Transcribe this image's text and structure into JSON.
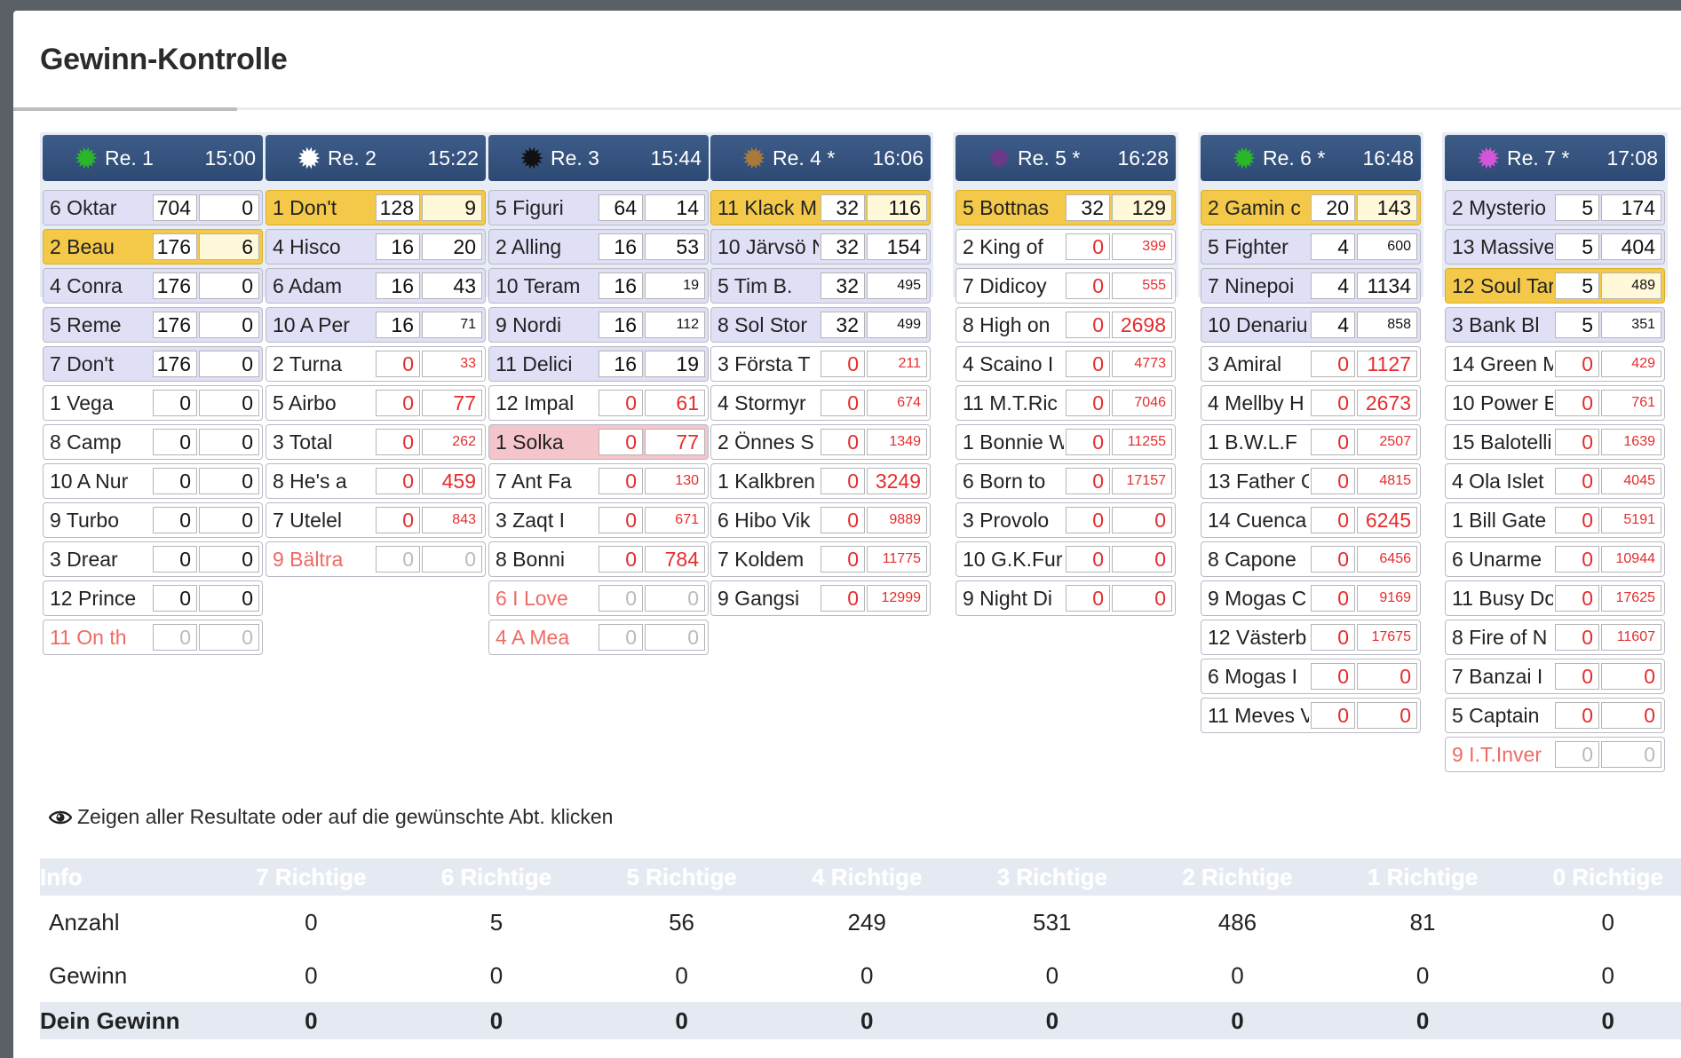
{
  "title": "Gewinn-Kontrolle",
  "races": [
    {
      "label": "Re. 1",
      "time": "15:00",
      "icon_color": "#2bb52b",
      "icon": "starburst-icon",
      "rows": [
        {
          "name": "6 Oktar",
          "v1": "704",
          "v2": "0",
          "style": "blue"
        },
        {
          "name": "2 Beau",
          "v1": "176",
          "v2": "6",
          "style": "gold"
        },
        {
          "name": "4 Conra",
          "v1": "176",
          "v2": "0",
          "style": "blue"
        },
        {
          "name": "5 Reme",
          "v1": "176",
          "v2": "0",
          "style": "blue"
        },
        {
          "name": "7 Don't",
          "v1": "176",
          "v2": "0",
          "style": "blue"
        },
        {
          "name": "1 Vega",
          "v1": "0",
          "v2": "0",
          "style": ""
        },
        {
          "name": "8 Camp",
          "v1": "0",
          "v2": "0",
          "style": ""
        },
        {
          "name": "10 A Nur",
          "v1": "0",
          "v2": "0",
          "style": ""
        },
        {
          "name": "9 Turbo",
          "v1": "0",
          "v2": "0",
          "style": ""
        },
        {
          "name": "3 Drear",
          "v1": "0",
          "v2": "0",
          "style": ""
        },
        {
          "name": "12 Prince",
          "v1": "0",
          "v2": "0",
          "style": ""
        },
        {
          "name": "11 On th",
          "v1": "0",
          "v2": "0",
          "style": "scratched"
        }
      ]
    },
    {
      "label": "Re. 2",
      "time": "15:22",
      "icon_color": "#ffffff",
      "icon": "starburst-icon",
      "rows": [
        {
          "name": "1 Don't",
          "v1": "128",
          "v2": "9",
          "style": "gold"
        },
        {
          "name": "4 Hisco",
          "v1": "16",
          "v2": "20",
          "style": "blue"
        },
        {
          "name": "6 Adam",
          "v1": "16",
          "v2": "43",
          "style": "blue"
        },
        {
          "name": "10 A Per",
          "v1": "16",
          "v2": "71",
          "style": "blue",
          "v2small": true
        },
        {
          "name": "2 Turna",
          "v1": "0",
          "v2": "33",
          "style": "",
          "red": true,
          "v2small": true
        },
        {
          "name": "5 Airbo",
          "v1": "0",
          "v2": "77",
          "style": "",
          "red": true
        },
        {
          "name": "3 Total",
          "v1": "0",
          "v2": "262",
          "style": "",
          "red": true,
          "v2small": true
        },
        {
          "name": "8 He's a",
          "v1": "0",
          "v2": "459",
          "style": "",
          "red": true
        },
        {
          "name": "7 Utelel",
          "v1": "0",
          "v2": "843",
          "style": "",
          "red": true,
          "v2small": true
        },
        {
          "name": "9 Bältra",
          "v1": "0",
          "v2": "0",
          "style": "scratched"
        }
      ]
    },
    {
      "label": "Re. 3",
      "time": "15:44",
      "icon_color": "#111111",
      "icon": "starburst-icon",
      "rows": [
        {
          "name": "5 Figuri",
          "v1": "64",
          "v2": "14",
          "style": "blue"
        },
        {
          "name": "2 Alling",
          "v1": "16",
          "v2": "53",
          "style": "blue"
        },
        {
          "name": "10 Teram",
          "v1": "16",
          "v2": "19",
          "style": "blue",
          "v2small": true
        },
        {
          "name": "9 Nordi",
          "v1": "16",
          "v2": "112",
          "style": "blue",
          "v2small": true
        },
        {
          "name": "11 Delici",
          "v1": "16",
          "v2": "19",
          "style": "blue"
        },
        {
          "name": "12 Impal",
          "v1": "0",
          "v2": "61",
          "style": "",
          "red": true
        },
        {
          "name": "1 Solka",
          "v1": "0",
          "v2": "77",
          "style": "pink",
          "red": true
        },
        {
          "name": "7 Ant Fa",
          "v1": "0",
          "v2": "130",
          "style": "",
          "red": true,
          "v2small": true
        },
        {
          "name": "3 Zaqt I",
          "v1": "0",
          "v2": "671",
          "style": "",
          "red": true,
          "v2small": true
        },
        {
          "name": "8 Bonni",
          "v1": "0",
          "v2": "784",
          "style": "",
          "red": true
        },
        {
          "name": "6 I Love",
          "v1": "0",
          "v2": "0",
          "style": "scratched"
        },
        {
          "name": "4 A Mea",
          "v1": "0",
          "v2": "0",
          "style": "scratched"
        }
      ]
    },
    {
      "label": "Re. 4 *",
      "time": "16:06",
      "icon_color": "#a77a3c",
      "icon": "starburst-icon",
      "rows": [
        {
          "name": "11 Klack M",
          "v1": "32",
          "v2": "116",
          "style": "gold"
        },
        {
          "name": "10 Järvsö N",
          "v1": "32",
          "v2": "154",
          "style": "blue"
        },
        {
          "name": "5 Tim B.",
          "v1": "32",
          "v2": "495",
          "style": "blue",
          "v2small": true
        },
        {
          "name": "8 Sol Stor",
          "v1": "32",
          "v2": "499",
          "style": "blue",
          "v2small": true
        },
        {
          "name": "3 Första T",
          "v1": "0",
          "v2": "211",
          "style": "",
          "red": true,
          "v2small": true
        },
        {
          "name": "4 Stormyr",
          "v1": "0",
          "v2": "674",
          "style": "",
          "red": true,
          "v2small": true
        },
        {
          "name": "2 Önnes S",
          "v1": "0",
          "v2": "1349",
          "style": "",
          "red": true,
          "v2small": true
        },
        {
          "name": "1 Kalkbren",
          "v1": "0",
          "v2": "3249",
          "style": "",
          "red": true
        },
        {
          "name": "6 Hibo Vik",
          "v1": "0",
          "v2": "9889",
          "style": "",
          "red": true,
          "v2small": true
        },
        {
          "name": "7 Koldem",
          "v1": "0",
          "v2": "11775",
          "style": "",
          "red": true,
          "v2small": true
        },
        {
          "name": "9 Gangsi",
          "v1": "0",
          "v2": "12999",
          "style": "",
          "red": true,
          "v2small": true
        }
      ]
    },
    {
      "label": "Re. 5 *",
      "time": "16:28",
      "icon_color": "#6a3a8a",
      "icon": "starburst-icon",
      "rows": [
        {
          "name": "5 Bottnas",
          "v1": "32",
          "v2": "129",
          "style": "gold"
        },
        {
          "name": "2 King of",
          "v1": "0",
          "v2": "399",
          "style": "",
          "red": true,
          "v2small": true
        },
        {
          "name": "7 Didicoy",
          "v1": "0",
          "v2": "555",
          "style": "",
          "red": true,
          "v2small": true
        },
        {
          "name": "8 High on",
          "v1": "0",
          "v2": "2698",
          "style": "",
          "red": true
        },
        {
          "name": "4 Scaino I",
          "v1": "0",
          "v2": "4773",
          "style": "",
          "red": true,
          "v2small": true
        },
        {
          "name": "11 M.T.Ric",
          "v1": "0",
          "v2": "7046",
          "style": "",
          "red": true,
          "v2small": true
        },
        {
          "name": "1 Bonnie W",
          "v1": "0",
          "v2": "11255",
          "style": "",
          "red": true,
          "v2small": true
        },
        {
          "name": "6 Born to",
          "v1": "0",
          "v2": "17157",
          "style": "",
          "red": true,
          "v2small": true
        },
        {
          "name": "3 Provolo",
          "v1": "0",
          "v2": "0",
          "style": "",
          "red": true
        },
        {
          "name": "10 G.K.Fur",
          "v1": "0",
          "v2": "0",
          "style": "",
          "red": true
        },
        {
          "name": "9 Night Di",
          "v1": "0",
          "v2": "0",
          "style": "",
          "red": true
        }
      ]
    },
    {
      "label": "Re. 6 *",
      "time": "16:48",
      "icon_color": "#2bb52b",
      "icon": "starburst-icon",
      "rows": [
        {
          "name": "2 Gamin c",
          "v1": "20",
          "v2": "143",
          "style": "gold"
        },
        {
          "name": "5 Fighter",
          "v1": "4",
          "v2": "600",
          "style": "blue",
          "v2small": true
        },
        {
          "name": "7 Ninepoi",
          "v1": "4",
          "v2": "1134",
          "style": "blue"
        },
        {
          "name": "10 Denariu",
          "v1": "4",
          "v2": "858",
          "style": "blue",
          "v2small": true
        },
        {
          "name": "3 Amiral",
          "v1": "0",
          "v2": "1127",
          "style": "",
          "red": true
        },
        {
          "name": "4 Mellby H",
          "v1": "0",
          "v2": "2673",
          "style": "",
          "red": true
        },
        {
          "name": "1 B.W.L.F",
          "v1": "0",
          "v2": "2507",
          "style": "",
          "red": true,
          "v2small": true
        },
        {
          "name": "13 Father C",
          "v1": "0",
          "v2": "4815",
          "style": "",
          "red": true,
          "v2small": true
        },
        {
          "name": "14 Cuenca",
          "v1": "0",
          "v2": "6245",
          "style": "",
          "red": true
        },
        {
          "name": "8 Capone",
          "v1": "0",
          "v2": "6456",
          "style": "",
          "red": true,
          "v2small": true
        },
        {
          "name": "9 Mogas C",
          "v1": "0",
          "v2": "9169",
          "style": "",
          "red": true,
          "v2small": true
        },
        {
          "name": "12 Västerb",
          "v1": "0",
          "v2": "17675",
          "style": "",
          "red": true,
          "v2small": true
        },
        {
          "name": "6 Mogas I",
          "v1": "0",
          "v2": "0",
          "style": "",
          "red": true
        },
        {
          "name": "11 Meves V",
          "v1": "0",
          "v2": "0",
          "style": "",
          "red": true
        }
      ]
    },
    {
      "label": "Re. 7 *",
      "time": "17:08",
      "icon_color": "#d256d6",
      "icon": "starburst-icon",
      "rows": [
        {
          "name": "2 Mysterio",
          "v1": "5",
          "v2": "174",
          "style": "blue"
        },
        {
          "name": "13 Massive",
          "v1": "5",
          "v2": "404",
          "style": "blue"
        },
        {
          "name": "12 Soul Tar",
          "v1": "5",
          "v2": "489",
          "style": "gold",
          "v2small": true
        },
        {
          "name": "3 Bank Bl",
          "v1": "5",
          "v2": "351",
          "style": "blue",
          "v2small": true
        },
        {
          "name": "14 Green M",
          "v1": "0",
          "v2": "429",
          "style": "",
          "red": true,
          "v2small": true
        },
        {
          "name": "10 Power E",
          "v1": "0",
          "v2": "761",
          "style": "",
          "red": true,
          "v2small": true
        },
        {
          "name": "15 Balotelli",
          "v1": "0",
          "v2": "1639",
          "style": "",
          "red": true,
          "v2small": true
        },
        {
          "name": "4 Ola Islet",
          "v1": "0",
          "v2": "4045",
          "style": "",
          "red": true,
          "v2small": true
        },
        {
          "name": "1 Bill Gate",
          "v1": "0",
          "v2": "5191",
          "style": "",
          "red": true,
          "v2small": true
        },
        {
          "name": "6 Unarme",
          "v1": "0",
          "v2": "10944",
          "style": "",
          "red": true,
          "v2small": true
        },
        {
          "name": "11 Busy Do",
          "v1": "0",
          "v2": "17625",
          "style": "",
          "red": true,
          "v2small": true
        },
        {
          "name": "8 Fire of N",
          "v1": "0",
          "v2": "11607",
          "style": "",
          "red": true,
          "v2small": true
        },
        {
          "name": "7 Banzai I",
          "v1": "0",
          "v2": "0",
          "style": "",
          "red": true
        },
        {
          "name": "5 Captain",
          "v1": "0",
          "v2": "0",
          "style": "",
          "red": true
        },
        {
          "name": "9 I.T.Inver",
          "v1": "0",
          "v2": "0",
          "style": "scratched"
        }
      ]
    }
  ],
  "hint": {
    "icon": "eye-icon",
    "text": "Zeigen aller Resultate oder auf die gewünschte Abt. klicken"
  },
  "results": {
    "headers": [
      "Info",
      "7 Richtige",
      "6 Richtige",
      "5 Richtige",
      "4 Richtige",
      "3 Richtige",
      "2 Richtige",
      "1 Richtige",
      "0 Richtige"
    ],
    "rows": [
      {
        "label": "Anzahl",
        "values": [
          "0",
          "5",
          "56",
          "249",
          "531",
          "486",
          "81",
          "0"
        ]
      },
      {
        "label": "Gewinn",
        "values": [
          "0",
          "0",
          "0",
          "0",
          "0",
          "0",
          "0",
          "0"
        ]
      },
      {
        "label": "Dein Gewinn",
        "values": [
          "0",
          "0",
          "0",
          "0",
          "0",
          "0",
          "0",
          "0"
        ]
      }
    ]
  }
}
